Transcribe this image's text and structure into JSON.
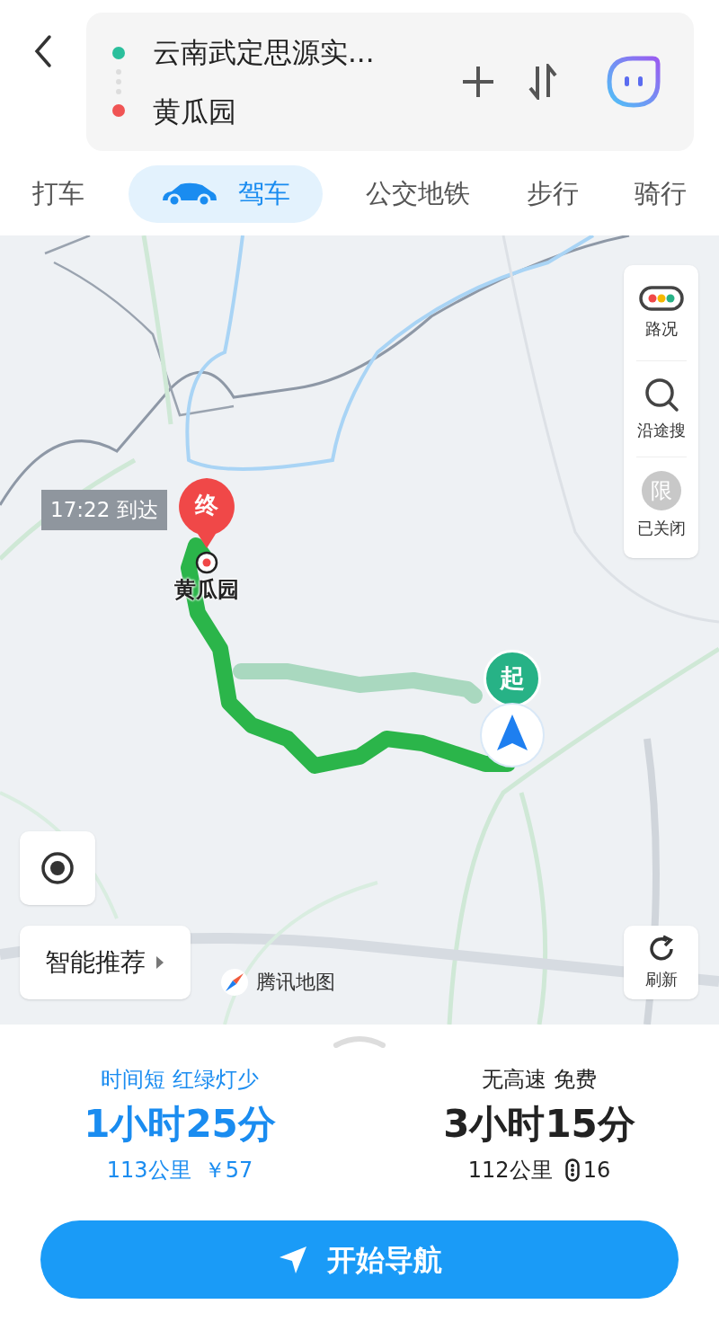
{
  "search": {
    "origin": "云南武定思源实...",
    "destination": "黄瓜园"
  },
  "tabs": [
    {
      "label": "打车",
      "selected": false
    },
    {
      "label": "驾车",
      "selected": true,
      "kind": "car"
    },
    {
      "label": "公交地铁",
      "selected": false
    },
    {
      "label": "步行",
      "selected": false
    },
    {
      "label": "骑行",
      "selected": false
    }
  ],
  "map": {
    "arrival_label": "17:22 到达",
    "end_marker": "终",
    "end_name": "黄瓜园",
    "start_marker": "起",
    "attribution": "腾讯地图"
  },
  "side_tools": [
    {
      "kind": "traffic",
      "label": "路况"
    },
    {
      "kind": "search",
      "label": "沿途搜"
    },
    {
      "kind": "limit",
      "glyph": "限",
      "label": "已关闭",
      "on": false
    }
  ],
  "recommend_button": "智能推荐",
  "refresh_button": "刷新",
  "routes": [
    {
      "tags": "时间短 红绿灯少",
      "duration": "1小时25分",
      "distance": "113公里",
      "cost": "￥57",
      "selected": true
    },
    {
      "tags": "无高速 免费",
      "duration": "3小时15分",
      "distance": "112公里",
      "lights": "16",
      "selected": false
    }
  ],
  "start_button": "开始导航"
}
